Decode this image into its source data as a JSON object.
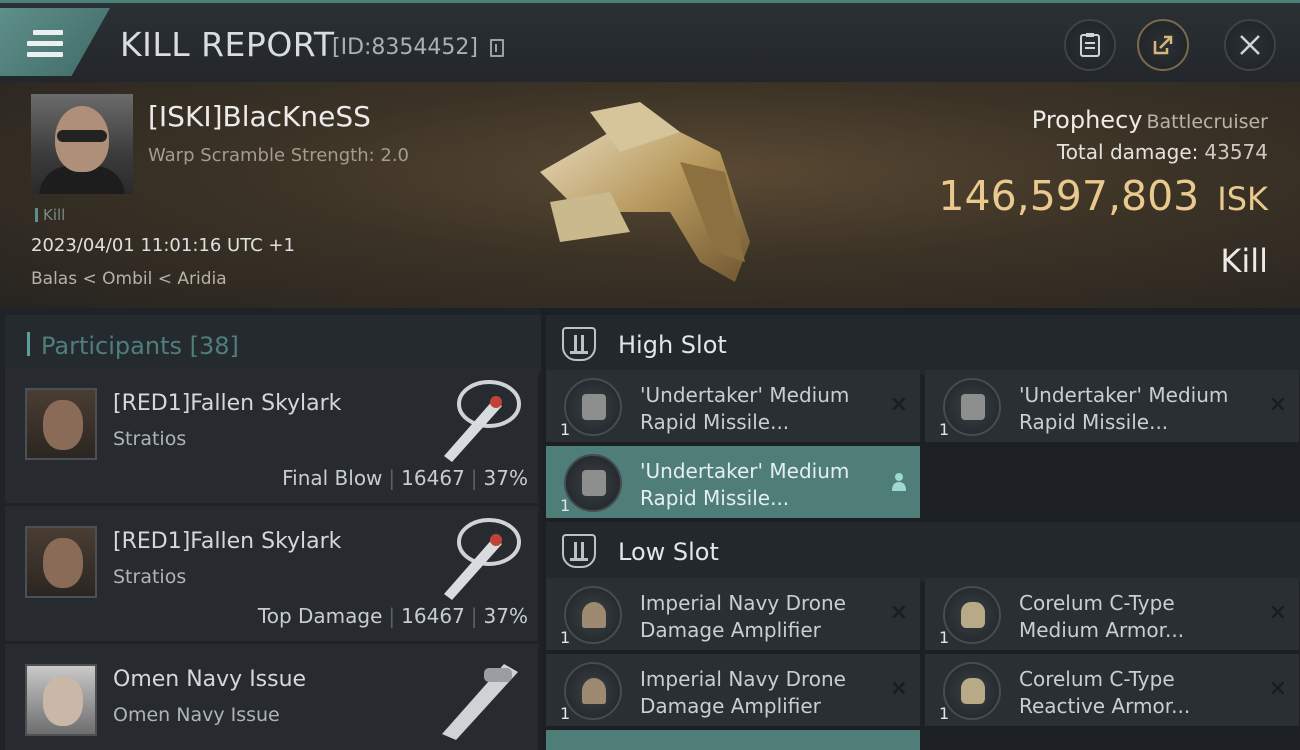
{
  "topbar": {
    "title": "KILL REPORT",
    "kill_id": "[ID:8354452]",
    "menu_icon": "hamburger-icon",
    "buttons": [
      "clipboard-icon",
      "share-icon",
      "close-icon"
    ]
  },
  "victim": {
    "name": "[ISKI]BlacKneSS",
    "warp": "Warp Scramble Strength: 2.0",
    "kill_tag": "Kill",
    "datetime": "2023/04/01 11:01:16 UTC +1",
    "location": "Balas < Ombil < Aridia",
    "ship_name": "Prophecy",
    "ship_class": "Battlecruiser",
    "total_damage_label": "Total damage:",
    "total_damage": "43574",
    "isk_value": "146,597,803",
    "isk_unit": "ISK",
    "result": "Kill"
  },
  "participants": {
    "label": "Participants [38]",
    "rows": [
      {
        "name": "[RED1]Fallen Skylark",
        "ship": "Stratios",
        "role": "Final Blow",
        "damage": "16467",
        "percent": "37%"
      },
      {
        "name": "[RED1]Fallen Skylark",
        "ship": "Stratios",
        "role": "Top Damage",
        "damage": "16467",
        "percent": "37%"
      },
      {
        "name": "Omen Navy Issue",
        "ship": "Omen Navy Issue",
        "role": "",
        "damage": "",
        "percent": ""
      }
    ]
  },
  "fitting": {
    "high_slot_label": "High Slot",
    "low_slot_label": "Low Slot",
    "high": [
      {
        "qty": "1",
        "name": "'Undertaker' Medium\nRapid Missile...",
        "state": "×"
      },
      {
        "qty": "1",
        "name": "'Undertaker' Medium\nRapid Missile...",
        "state": "×"
      },
      {
        "qty": "1",
        "name": "'Undertaker' Medium\nRapid Missile...",
        "state": "person"
      }
    ],
    "low": [
      {
        "qty": "1",
        "name": "Imperial Navy Drone\nDamage Amplifier",
        "state": "×"
      },
      {
        "qty": "1",
        "name": "Corelum C-Type\nMedium Armor...",
        "state": "×"
      },
      {
        "qty": "1",
        "name": "Imperial Navy Drone\nDamage Amplifier",
        "state": "×"
      },
      {
        "qty": "1",
        "name": "Corelum C-Type\nReactive Armor...",
        "state": "×"
      }
    ]
  }
}
